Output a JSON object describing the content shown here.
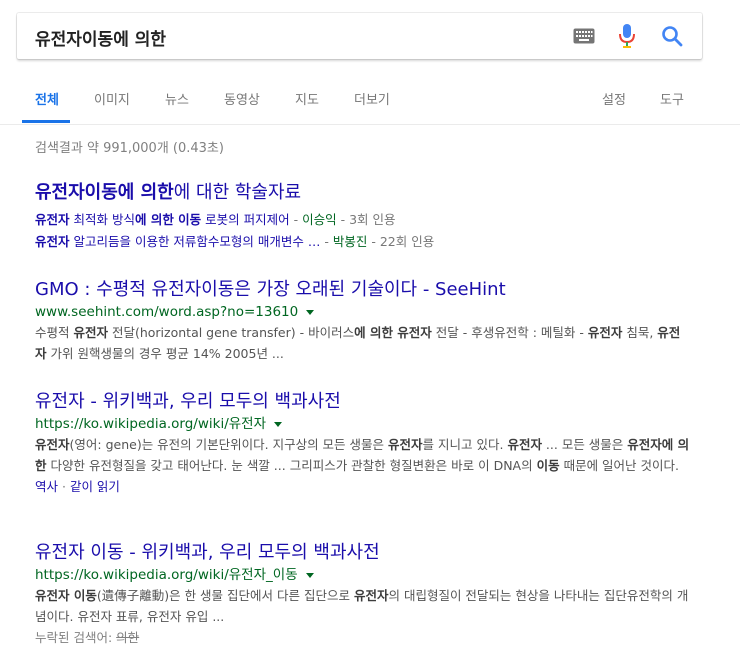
{
  "search": {
    "query": "유전자이동에 의한"
  },
  "tabs": [
    {
      "label": "전체"
    },
    {
      "label": "이미지"
    },
    {
      "label": "뉴스"
    },
    {
      "label": "동영상"
    },
    {
      "label": "지도"
    },
    {
      "label": "더보기"
    },
    {
      "label": "설정"
    },
    {
      "label": "도구"
    }
  ],
  "stats": "검색결과 약 991,000개 (0.43초)",
  "scholar": {
    "title_bold": "유전자이동에 의한",
    "title_rest": "에 대한 학술자료",
    "items": [
      {
        "b1": "유전자",
        "t1": " 최적화 방식",
        "b2": "에 의한 이동",
        "t2": " 로봇의 퍼지제어",
        "dash": " - ",
        "author": "이승익",
        "cite": " - 3회 인용"
      },
      {
        "b1": "유전자",
        "t1": " 알고리듬을 이용한 저류함수모형의 매개변수 …",
        "b2": "",
        "t2": "",
        "dash": " - ",
        "author": "박봉진",
        "cite": " - 22회 인용"
      }
    ]
  },
  "results": [
    {
      "title": "GMO : 수평적 유전자이동은 가장 오래된 기술이다 - SeeHint",
      "url": "www.seehint.com/word.asp?no=13610",
      "snippet": [
        {
          "t": "수평적 "
        },
        {
          "b": "유전자"
        },
        {
          "t": " 전달(horizontal gene transfer) - 바이러스"
        },
        {
          "b": "에 의한 유전자"
        },
        {
          "t": " 전달 - 후생유전학 : 메틸화 - "
        },
        {
          "b": "유전자"
        },
        {
          "t": " 침묵, "
        },
        {
          "b": "유전자"
        },
        {
          "t": " 가위 원핵생물의 경우 평균 14% 2005년 ..."
        }
      ]
    },
    {
      "title": "유전자 - 위키백과, 우리 모두의 백과사전",
      "url": "https://ko.wikipedia.org/wiki/유전자",
      "snippet": [
        {
          "b": "유전자"
        },
        {
          "t": "(영어: gene)는 유전의 기본단위이다. 지구상의 모든 생물은 "
        },
        {
          "b": "유전자"
        },
        {
          "t": "를 지니고 있다. "
        },
        {
          "b": "유전자"
        },
        {
          "t": " ... 모든 생물은 "
        },
        {
          "b": "유전자에 의한"
        },
        {
          "t": " 다양한 유전형질을 갖고 태어난다. 눈 색깔 ... 그리피스가 관찰한 형질변환은 바로 이 DNA의 "
        },
        {
          "b": "이동"
        },
        {
          "t": " 때문에 일어난 것이다."
        }
      ],
      "links": [
        "역사",
        "같이 읽기"
      ],
      "links_sep": " · "
    },
    {
      "title": "유전자 이동 - 위키백과, 우리 모두의 백과사전",
      "url": "https://ko.wikipedia.org/wiki/유전자_이동",
      "snippet": [
        {
          "b": "유전자 이동"
        },
        {
          "t": "(遺傳子離動)은 한 생물 집단에서 다른 집단으로 "
        },
        {
          "b": "유전자"
        },
        {
          "t": "의 대립형질이 전달되는 현상을 나타내는 집단유전학의 개념이다. 유전자 표류, 유전자 유입 ..."
        }
      ],
      "missing_label": "누락된 검색어: ",
      "missing_term": "의한"
    }
  ]
}
